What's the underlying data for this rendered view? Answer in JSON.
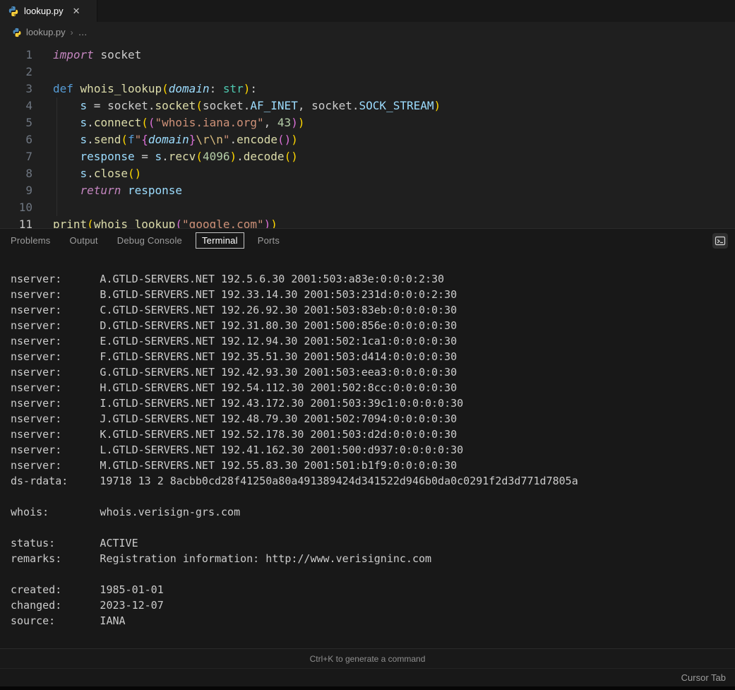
{
  "window": {
    "tab": {
      "label": "lookup.py",
      "close_glyph": "✕"
    },
    "breadcrumb": {
      "file": "lookup.py",
      "separator": "›",
      "more": "…"
    }
  },
  "colors": {
    "editor_bg": "#1f1f1f",
    "panel_bg": "#181818",
    "terminal_fg": "#cccccc",
    "keyword": "#569cd6",
    "control_keyword": "#c586c0",
    "function": "#dcdcaa",
    "variable": "#9cdcfe",
    "string": "#ce9178",
    "number": "#b5cea8"
  },
  "editor": {
    "lines": [
      {
        "n": "1",
        "active": false,
        "tokens": [
          [
            "ctrl",
            "import"
          ],
          [
            "fg",
            " "
          ],
          [
            "fg",
            "socket"
          ]
        ]
      },
      {
        "n": "2",
        "active": false,
        "tokens": []
      },
      {
        "n": "3",
        "active": false,
        "tokens": [
          [
            "kw",
            "def"
          ],
          [
            "fg",
            " "
          ],
          [
            "fn",
            "whois_lookup"
          ],
          [
            "b1",
            "("
          ],
          [
            "param",
            "domain"
          ],
          [
            "fg",
            ": "
          ],
          [
            "type",
            "str"
          ],
          [
            "b1",
            ")"
          ],
          [
            "fg",
            ":"
          ]
        ]
      },
      {
        "n": "4",
        "active": false,
        "tokens": [
          [
            "fg",
            "    "
          ],
          [
            "var",
            "s"
          ],
          [
            "fg",
            " = "
          ],
          [
            "fg",
            "socket"
          ],
          [
            "fg",
            "."
          ],
          [
            "fn",
            "socket"
          ],
          [
            "b1",
            "("
          ],
          [
            "fg",
            "socket"
          ],
          [
            "fg",
            "."
          ],
          [
            "var",
            "AF_INET"
          ],
          [
            "fg",
            ", "
          ],
          [
            "fg",
            "socket"
          ],
          [
            "fg",
            "."
          ],
          [
            "var",
            "SOCK_STREAM"
          ],
          [
            "b1",
            ")"
          ]
        ]
      },
      {
        "n": "5",
        "active": false,
        "tokens": [
          [
            "fg",
            "    "
          ],
          [
            "var",
            "s"
          ],
          [
            "fg",
            "."
          ],
          [
            "fn",
            "connect"
          ],
          [
            "b1",
            "("
          ],
          [
            "b2",
            "("
          ],
          [
            "str",
            "\"whois.iana.org\""
          ],
          [
            "fg",
            ", "
          ],
          [
            "num",
            "43"
          ],
          [
            "b2",
            ")"
          ],
          [
            "b1",
            ")"
          ]
        ]
      },
      {
        "n": "6",
        "active": false,
        "tokens": [
          [
            "fg",
            "    "
          ],
          [
            "var",
            "s"
          ],
          [
            "fg",
            "."
          ],
          [
            "fn",
            "send"
          ],
          [
            "b1",
            "("
          ],
          [
            "kw",
            "f"
          ],
          [
            "str",
            "\""
          ],
          [
            "b2",
            "{"
          ],
          [
            "param",
            "domain"
          ],
          [
            "b2",
            "}"
          ],
          [
            "esc",
            "\\r\\n"
          ],
          [
            "str",
            "\""
          ],
          [
            "fg",
            "."
          ],
          [
            "fn",
            "encode"
          ],
          [
            "b2",
            "()"
          ],
          [
            "b1",
            ")"
          ]
        ]
      },
      {
        "n": "7",
        "active": false,
        "tokens": [
          [
            "fg",
            "    "
          ],
          [
            "var",
            "response"
          ],
          [
            "fg",
            " = "
          ],
          [
            "var",
            "s"
          ],
          [
            "fg",
            "."
          ],
          [
            "fn",
            "recv"
          ],
          [
            "b1",
            "("
          ],
          [
            "num",
            "4096"
          ],
          [
            "b1",
            ")"
          ],
          [
            "fg",
            "."
          ],
          [
            "fn",
            "decode"
          ],
          [
            "b1",
            "()"
          ]
        ]
      },
      {
        "n": "8",
        "active": false,
        "tokens": [
          [
            "fg",
            "    "
          ],
          [
            "var",
            "s"
          ],
          [
            "fg",
            "."
          ],
          [
            "fn",
            "close"
          ],
          [
            "b1",
            "()"
          ]
        ]
      },
      {
        "n": "9",
        "active": false,
        "tokens": [
          [
            "fg",
            "    "
          ],
          [
            "ctrl",
            "return"
          ],
          [
            "fg",
            " "
          ],
          [
            "var",
            "response"
          ]
        ]
      },
      {
        "n": "10",
        "active": false,
        "tokens": []
      },
      {
        "n": "11",
        "active": true,
        "tokens": [
          [
            "fn",
            "print"
          ],
          [
            "b1",
            "("
          ],
          [
            "fn",
            "whois_lookup"
          ],
          [
            "b2",
            "("
          ],
          [
            "str",
            "\"google.com\""
          ],
          [
            "b2",
            ")"
          ],
          [
            "b1",
            ")"
          ]
        ]
      }
    ]
  },
  "panel": {
    "tabs": [
      {
        "label": "Problems",
        "active": false
      },
      {
        "label": "Output",
        "active": false
      },
      {
        "label": "Debug Console",
        "active": false
      },
      {
        "label": "Terminal",
        "active": true
      },
      {
        "label": "Ports",
        "active": false
      }
    ],
    "launch_icon": "terminal-launch-icon"
  },
  "terminal": {
    "lines": [
      "nserver:      A.GTLD-SERVERS.NET 192.5.6.30 2001:503:a83e:0:0:0:2:30",
      "nserver:      B.GTLD-SERVERS.NET 192.33.14.30 2001:503:231d:0:0:0:2:30",
      "nserver:      C.GTLD-SERVERS.NET 192.26.92.30 2001:503:83eb:0:0:0:0:30",
      "nserver:      D.GTLD-SERVERS.NET 192.31.80.30 2001:500:856e:0:0:0:0:30",
      "nserver:      E.GTLD-SERVERS.NET 192.12.94.30 2001:502:1ca1:0:0:0:0:30",
      "nserver:      F.GTLD-SERVERS.NET 192.35.51.30 2001:503:d414:0:0:0:0:30",
      "nserver:      G.GTLD-SERVERS.NET 192.42.93.30 2001:503:eea3:0:0:0:0:30",
      "nserver:      H.GTLD-SERVERS.NET 192.54.112.30 2001:502:8cc:0:0:0:0:30",
      "nserver:      I.GTLD-SERVERS.NET 192.43.172.30 2001:503:39c1:0:0:0:0:30",
      "nserver:      J.GTLD-SERVERS.NET 192.48.79.30 2001:502:7094:0:0:0:0:30",
      "nserver:      K.GTLD-SERVERS.NET 192.52.178.30 2001:503:d2d:0:0:0:0:30",
      "nserver:      L.GTLD-SERVERS.NET 192.41.162.30 2001:500:d937:0:0:0:0:30",
      "nserver:      M.GTLD-SERVERS.NET 192.55.83.30 2001:501:b1f9:0:0:0:0:30",
      "ds-rdata:     19718 13 2 8acbb0cd28f41250a80a491389424d341522d946b0da0c0291f2d3d771d7805a",
      "",
      "whois:        whois.verisign-grs.com",
      "",
      "status:       ACTIVE",
      "remarks:      Registration information: http://www.verisigninc.com",
      "",
      "created:      1985-01-01",
      "changed:      2023-12-07",
      "source:       IANA"
    ]
  },
  "hint_bar": {
    "text": "Ctrl+K to generate a command"
  },
  "status_bar": {
    "right": "Cursor Tab"
  }
}
